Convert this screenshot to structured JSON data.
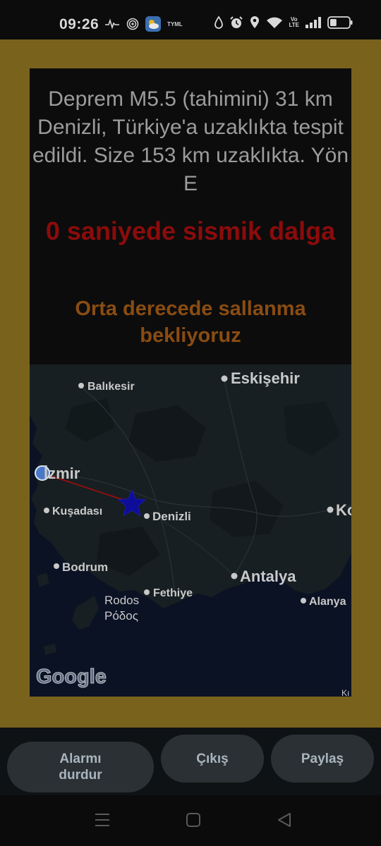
{
  "status_bar": {
    "time": "09:26",
    "carrier_badge": "TYML",
    "volte_top": "Vo",
    "volte_bottom": "LTE",
    "icons": [
      "activity-icon",
      "hotspot-icon",
      "weather-app-icon",
      "water-drop-icon",
      "alarm-icon",
      "location-icon",
      "wifi-icon",
      "volte-icon",
      "signal-icon",
      "battery-icon"
    ],
    "battery_level": 0.35
  },
  "alert": {
    "message": "Deprem M5.5 (tahimini) 31 km Denizli, Türkiye'a uzaklıkta tespit edildi. Size 153 km uzaklıkta. Yön E",
    "wave": "0 saniyede sismik dalga",
    "shaking": "Orta derecede sallanma bekliyoruz"
  },
  "map": {
    "labels": {
      "balikesir": "Balıkesir",
      "eskisehir": "Eskişehir",
      "izmir": "İzmir",
      "kusadasi": "Kuşadası",
      "denizli": "Denizli",
      "konya_partial": "Ko",
      "bodrum": "Bodrum",
      "antalya": "Antalya",
      "fethiye": "Fethiye",
      "rodos": "Rodos",
      "rodos_greek": "Ρόδος",
      "alanya": "Alanya",
      "corner_partial": "Kı",
      "attribution": "Google"
    }
  },
  "buttons": {
    "stop_alarm_line1": "Alarmı",
    "stop_alarm_line2": "durdur",
    "exit": "Çıkış",
    "share": "Paylaş"
  },
  "colors": {
    "frame_gold": "#79621c",
    "wave_red": "#8c0b0b",
    "shake_orange": "#8a4c12",
    "epicenter_blue": "#0d0d9a",
    "user_location_blue": "#4a78c8",
    "sea": "#0b1224",
    "land": "#171f22"
  }
}
